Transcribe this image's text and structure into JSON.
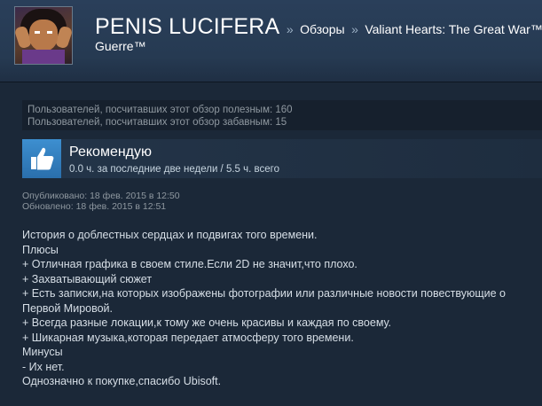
{
  "header": {
    "username": "PENIS LUCIFERA",
    "separator": "»",
    "crumb_reviews": "Обзоры",
    "crumb_game": "Valiant Hearts: The Great War™ /",
    "crumb_game_line2": "Guerre™"
  },
  "ratings": {
    "helpful": "Пользователей, посчитавших этот обзор полезным: 160",
    "funny": "Пользователей, посчитавших этот обзор забавным: 15"
  },
  "recommendation": {
    "icon": "thumbs-up-icon",
    "title": "Рекомендую",
    "hours": "0.0 ч. за последние две недели / 5.5 ч. всего"
  },
  "dates": {
    "posted": "Опубликовано: 18 фев. 2015 в 12:50",
    "updated": "Обновлено: 18 фев. 2015 в 12:51"
  },
  "review_lines": [
    "История о доблестных сердцах и подвигах того времени.",
    "Плюсы",
    "+ Отличная графика в своем стиле.Если 2D не значит,что плохо.",
    "+ Захватывающий сюжет",
    "+ Есть записки,на которых изображены фотографии или различные новости повествующие о",
    "Первой Мировой.",
    "+ Всегда разные локации,к тому же очень красивы и каждая по своему.",
    "+ Шикарная музыка,которая передает атмосферу того времени.",
    "Минусы",
    "- Их нет.",
    "Однозначно к покупке,спасибо Ubisoft."
  ],
  "colors": {
    "page_bg": "#1b2838",
    "header_bg": "#2a3f5a",
    "thumb_bg": "#3d8fd0",
    "muted_text": "#8f98a0"
  }
}
